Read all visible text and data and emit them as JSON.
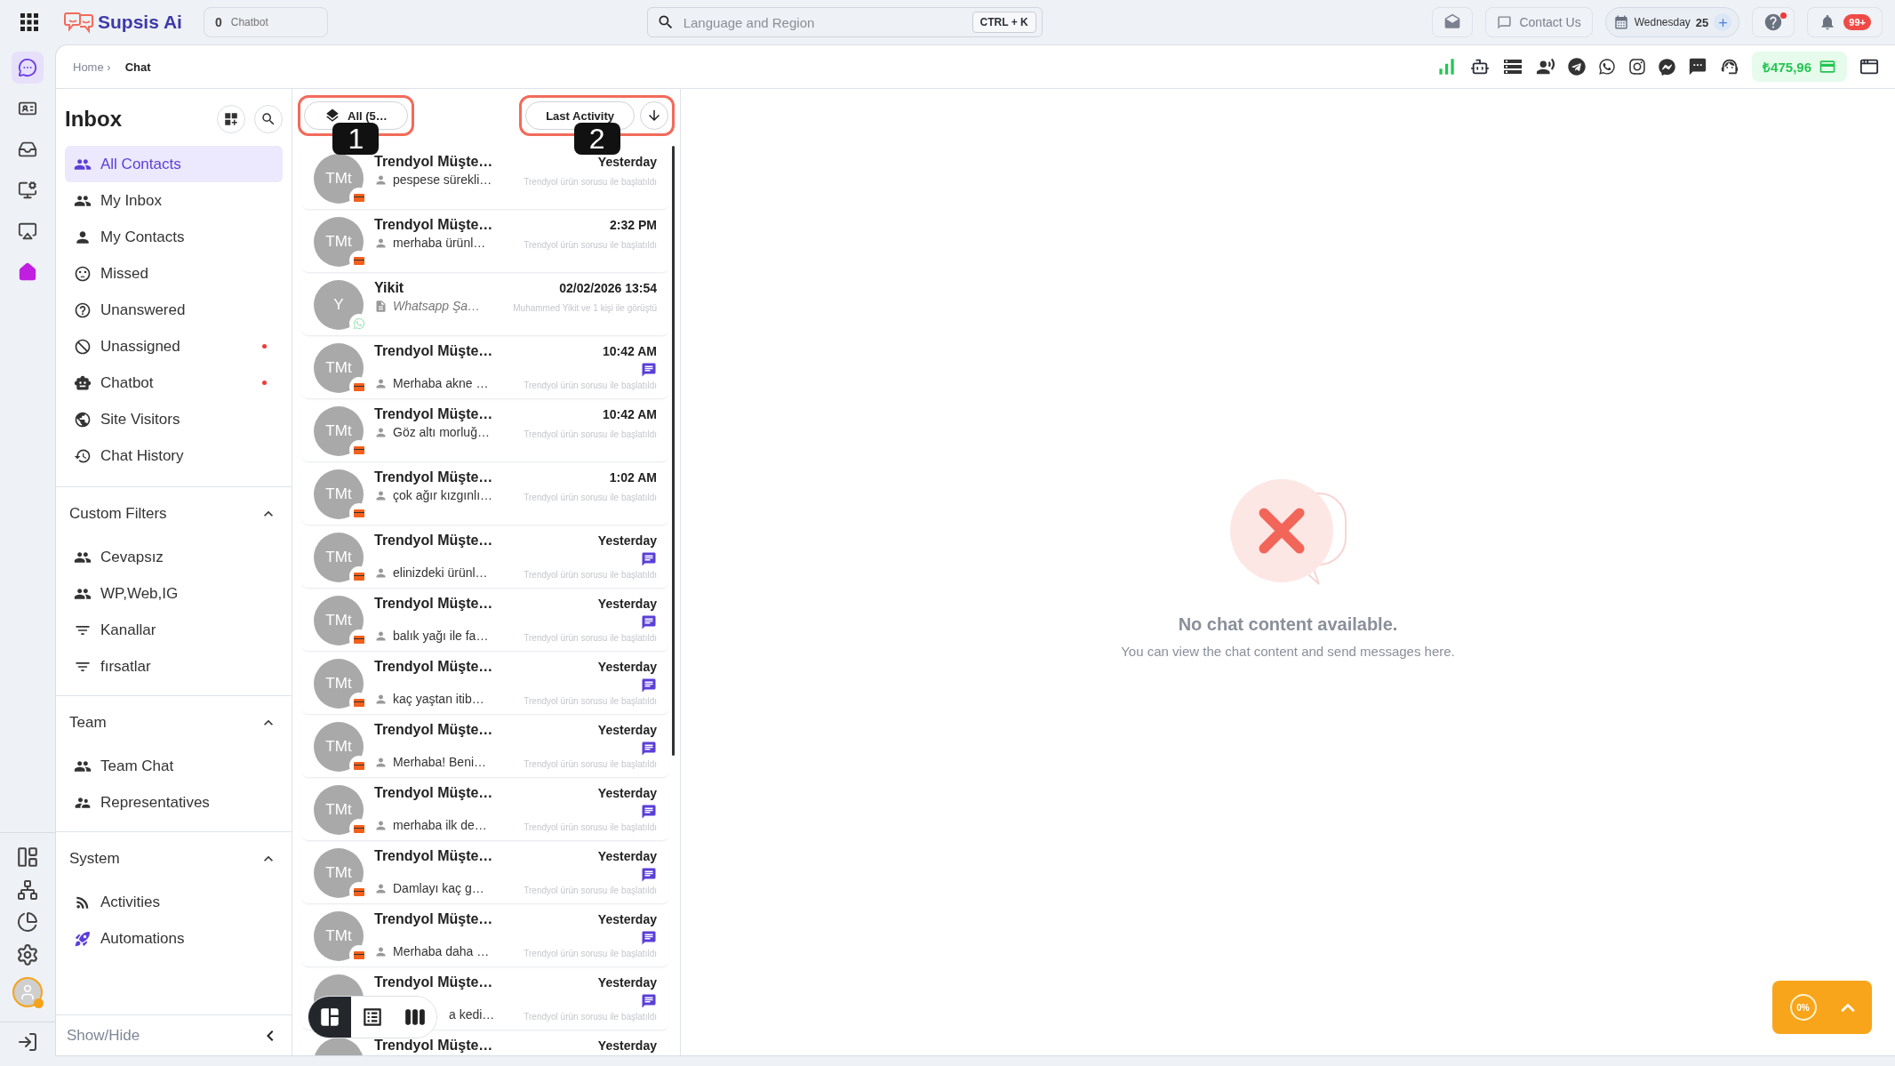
{
  "top_bar": {
    "brand": "Supsis Ai",
    "chatbot_count": "0",
    "chatbot_label": "Chatbot",
    "search": {
      "value": "Language and Region",
      "shortcut": "CTRL + K"
    },
    "contact": "Contact Us",
    "date": {
      "day": "Wednesday",
      "number": "25"
    },
    "help_alert": true,
    "notifications": "99+"
  },
  "rail": [
    {
      "selected": true
    },
    {
      "selected": false
    },
    {
      "selected": false
    },
    {
      "selected": false
    },
    {
      "selected": false
    },
    {
      "selected": false
    }
  ],
  "breadcrumb": {
    "home": "Home ›",
    "current": "Chat"
  },
  "balance": "₺475,96",
  "inbox": {
    "title": "Inbox",
    "items": [
      {
        "label": "All Contacts",
        "selected": true,
        "alert": false
      },
      {
        "label": "My Inbox",
        "selected": false,
        "alert": false
      },
      {
        "label": "My Contacts",
        "selected": false,
        "alert": false
      },
      {
        "label": "Missed",
        "selected": false,
        "alert": false
      },
      {
        "label": "Unanswered",
        "selected": false,
        "alert": false
      },
      {
        "label": "Unassigned",
        "selected": false,
        "alert": true
      },
      {
        "label": "Chatbot",
        "selected": false,
        "alert": true
      },
      {
        "label": "Site Visitors",
        "selected": false,
        "alert": false
      },
      {
        "label": "Chat History",
        "selected": false,
        "alert": false
      }
    ],
    "sections": [
      {
        "title": "Custom Filters",
        "expanded": true,
        "items": [
          {
            "label": "Cevapsız",
            "kind": "group"
          },
          {
            "label": "WP,Web,IG",
            "kind": "group"
          },
          {
            "label": "Kanallar",
            "kind": "filter"
          },
          {
            "label": "fırsatlar",
            "kind": "filter"
          }
        ]
      },
      {
        "title": "Team",
        "expanded": true,
        "items": [
          {
            "label": "Team Chat",
            "kind": "group"
          },
          {
            "label": "Representatives",
            "kind": "reps"
          }
        ]
      },
      {
        "title": "System",
        "expanded": true,
        "items": [
          {
            "label": "Activities",
            "kind": "feed"
          },
          {
            "label": "Automations",
            "kind": "rocket"
          }
        ]
      }
    ],
    "footer": "Show/Hide"
  },
  "list": {
    "filter": {
      "label": "All (5…",
      "callout": "1"
    },
    "sort": {
      "label": "Last Activity",
      "callout": "2"
    },
    "rows": [
      {
        "kind": "marketplace",
        "initials": "TMt",
        "name": "Trendyol Müşte…",
        "time": "Yesterday",
        "preview": "pespese sürekli…",
        "note": "Trendyol ürün sorusu ile başlatıldı",
        "unread": false
      },
      {
        "kind": "marketplace",
        "initials": "TMt",
        "name": "Trendyol Müşte…",
        "time": "2:32 PM",
        "preview": "merhaba ürünl…",
        "note": "Trendyol ürün sorusu ile başlatıldı",
        "unread": false
      },
      {
        "kind": "messaging",
        "initials": "Y",
        "name": "Yikit",
        "time": "02/02/2026 13:54",
        "preview": "Whatsapp Şa…",
        "note": "Muhammed Yikit ve 1 kişi ile görüştü",
        "unread": false
      },
      {
        "kind": "marketplace",
        "initials": "TMt",
        "name": "Trendyol Müşte…",
        "time": "10:42 AM",
        "preview": "Merhaba akne …",
        "note": "Trendyol ürün sorusu ile başlatıldı",
        "unread": true
      },
      {
        "kind": "marketplace",
        "initials": "TMt",
        "name": "Trendyol Müşte…",
        "time": "10:42 AM",
        "preview": "Göz altı morluğ…",
        "note": "Trendyol ürün sorusu ile başlatıldı",
        "unread": false
      },
      {
        "kind": "marketplace",
        "initials": "TMt",
        "name": "Trendyol Müşte…",
        "time": "1:02 AM",
        "preview": "çok ağır kızgınlı…",
        "note": "Trendyol ürün sorusu ile başlatıldı",
        "unread": false
      },
      {
        "kind": "marketplace",
        "initials": "TMt",
        "name": "Trendyol Müşte…",
        "time": "Yesterday",
        "preview": "elinizdeki ürünl…",
        "note": "Trendyol ürün sorusu ile başlatıldı",
        "unread": true
      },
      {
        "kind": "marketplace",
        "initials": "TMt",
        "name": "Trendyol Müşte…",
        "time": "Yesterday",
        "preview": "balık yağı ile fa…",
        "note": "Trendyol ürün sorusu ile başlatıldı",
        "unread": true
      },
      {
        "kind": "marketplace",
        "initials": "TMt",
        "name": "Trendyol Müşte…",
        "time": "Yesterday",
        "preview": "kaç yaştan itib…",
        "note": "Trendyol ürün sorusu ile başlatıldı",
        "unread": true
      },
      {
        "kind": "marketplace",
        "initials": "TMt",
        "name": "Trendyol Müşte…",
        "time": "Yesterday",
        "preview": "Merhaba! Beni…",
        "note": "Trendyol ürün sorusu ile başlatıldı",
        "unread": true
      },
      {
        "kind": "marketplace",
        "initials": "TMt",
        "name": "Trendyol Müşte…",
        "time": "Yesterday",
        "preview": "merhaba ilk de…",
        "note": "Trendyol ürün sorusu ile başlatıldı",
        "unread": true
      },
      {
        "kind": "marketplace",
        "initials": "TMt",
        "name": "Trendyol Müşte…",
        "time": "Yesterday",
        "preview": "Damlayı kaç g…",
        "note": "Trendyol ürün sorusu ile başlatıldı",
        "unread": true
      },
      {
        "kind": "marketplace",
        "initials": "TMt",
        "name": "Trendyol Müşte…",
        "time": "Yesterday",
        "preview": "Merhaba daha …",
        "note": "Trendyol ürün sorusu ile başlatıldı",
        "unread": true
      },
      {
        "kind": "hidden",
        "name": "Trendyol Müşte…",
        "time": "Yesterday",
        "preview": "a kedi…",
        "note": "Trendyol ürün sorusu ile başlatıldı",
        "unread": true
      },
      {
        "kind": "hidden",
        "name": "Trendyol Müşte…",
        "time": "Yesterday",
        "unread": false
      }
    ],
    "views": [
      {
        "selected": true
      },
      {
        "selected": false
      },
      {
        "selected": false
      }
    ]
  },
  "empty": {
    "title": "No chat content available.",
    "text": "You can view the chat content and send messages here."
  },
  "progress_widget": {
    "label": "0%"
  }
}
